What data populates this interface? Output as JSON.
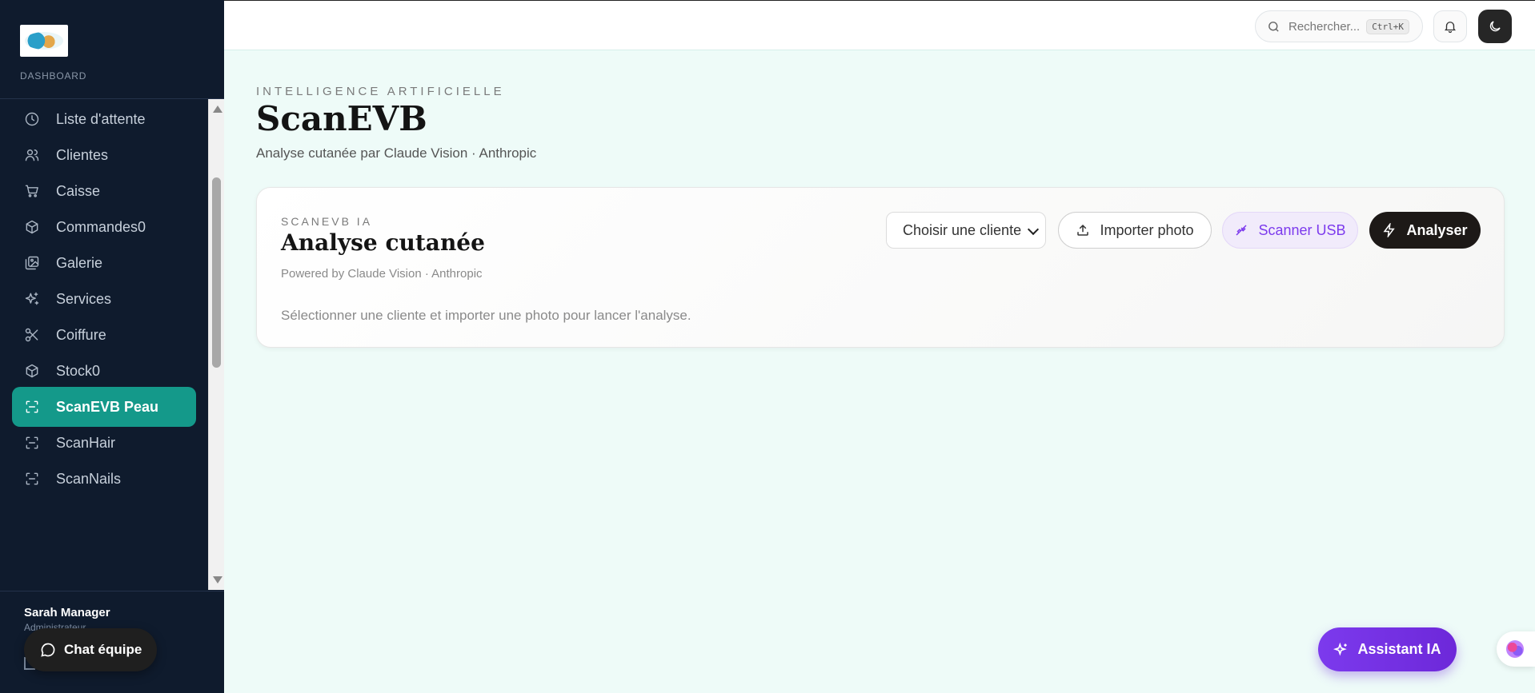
{
  "sidebar": {
    "section_label": "DASHBOARD",
    "items": [
      {
        "label": "Liste d'attente",
        "icon": "clock-icon"
      },
      {
        "label": "Clientes",
        "icon": "users-icon"
      },
      {
        "label": "Caisse",
        "icon": "cart-icon"
      },
      {
        "label": "Commandes0",
        "icon": "box-icon"
      },
      {
        "label": "Galerie",
        "icon": "gallery-icon"
      },
      {
        "label": "Services",
        "icon": "sparkles-icon"
      },
      {
        "label": "Coiffure",
        "icon": "scissors-icon"
      },
      {
        "label": "Stock0",
        "icon": "box-icon"
      },
      {
        "label": "ScanEVB Peau",
        "icon": "scan-icon",
        "active": true
      },
      {
        "label": "ScanHair",
        "icon": "scan-icon"
      },
      {
        "label": "ScanNails",
        "icon": "scan-icon"
      }
    ],
    "user": {
      "name": "Sarah Manager",
      "role": "Administrateur"
    },
    "chat_button": "Chat équipe"
  },
  "topbar": {
    "search_placeholder": "Rechercher...",
    "shortcut": "Ctrl+K"
  },
  "header": {
    "eyebrow": "INTELLIGENCE ARTIFICIELLE",
    "title": "ScanEVB",
    "subtitle": "Analyse cutanée par Claude Vision · Anthropic"
  },
  "card": {
    "eyebrow": "SCANEVB IA",
    "title": "Analyse cutanée",
    "powered": "Powered by Claude Vision · Anthropic",
    "message": "Sélectionner une cliente et importer une photo pour lancer l'analyse.",
    "select_value": "Choisir une cliente",
    "import_label": "Importer photo",
    "usb_label": "Scanner USB",
    "analyze_label": "Analyser"
  },
  "assistant_label": "Assistant IA",
  "colors": {
    "sidebar_bg": "#0f1b2d",
    "accent": "#14998a",
    "page_bg": "#eefbf8",
    "purple": "#7c3aed"
  }
}
